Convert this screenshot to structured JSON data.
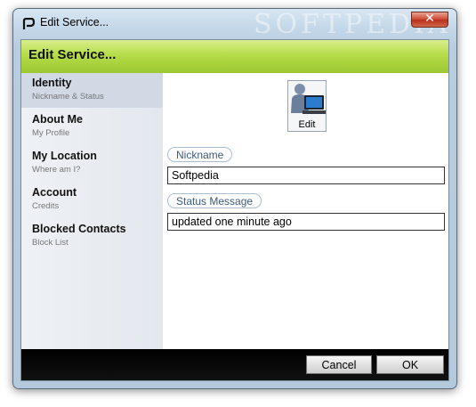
{
  "window": {
    "title": "Edit Service...",
    "close_symbol": "✕",
    "app_icon": "pidgin-icon",
    "watermark": "SOFTPEDIA"
  },
  "header": {
    "title": "Edit Service..."
  },
  "sidebar": {
    "items": [
      {
        "title": "Identity",
        "subtitle": "Nickname & Status",
        "active": true
      },
      {
        "title": "About Me",
        "subtitle": "My Profile",
        "active": false
      },
      {
        "title": "My Location",
        "subtitle": "Where am I?",
        "active": false
      },
      {
        "title": "Account",
        "subtitle": "Credits",
        "active": false
      },
      {
        "title": "Blocked Contacts",
        "subtitle": "Block List",
        "active": false
      }
    ]
  },
  "identity": {
    "avatar_icon": "user-at-computer-icon",
    "edit_label": "Edit",
    "nickname_label": "Nickname",
    "nickname_value": "Softpedia",
    "status_label": "Status Message",
    "status_value": "updated one minute ago"
  },
  "footer": {
    "cancel_label": "Cancel",
    "ok_label": "OK"
  },
  "colors": {
    "header_green": "#b6dc48",
    "footer_black": "#000000",
    "close_red": "#c8402a",
    "sidebar_active": "#d0d9e4"
  }
}
